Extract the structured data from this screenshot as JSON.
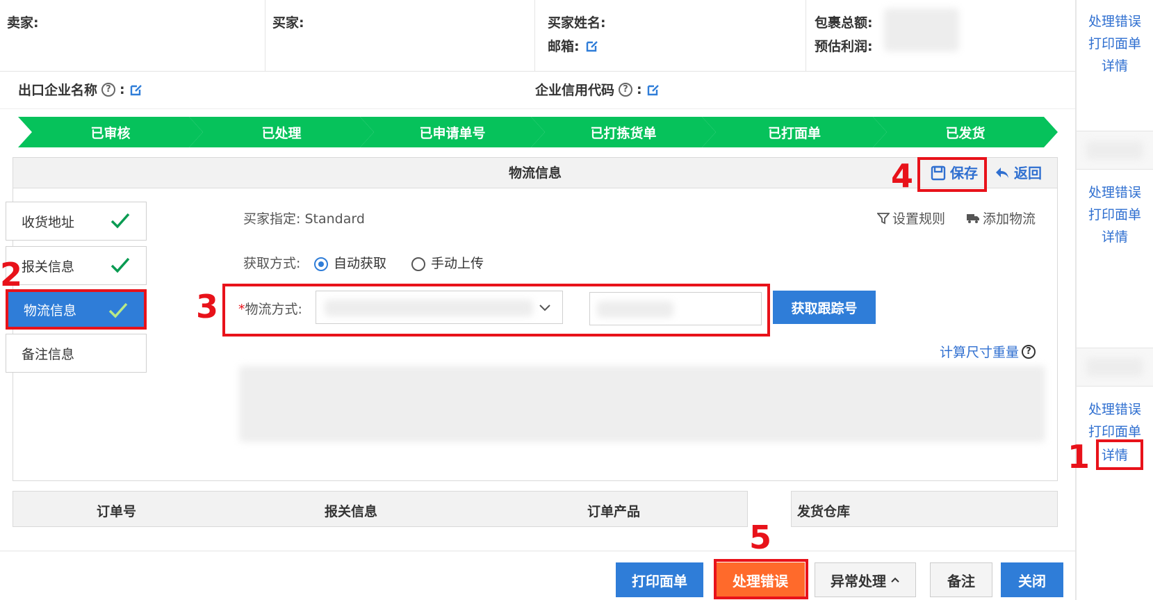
{
  "header": {
    "seller_label": "卖家:",
    "buyer_label": "买家:",
    "buyer_name_label": "买家姓名:",
    "email_label": "邮箱:",
    "package_total_label": "包裹总额:",
    "est_profit_label": "预估利润:"
  },
  "corp": {
    "export_company_label": "出口企业名称",
    "credit_code_label": "企业信用代码",
    "colon": ":"
  },
  "steps": [
    "已审核",
    "已处理",
    "已申请单号",
    "已打拣货单",
    "已打面单",
    "已发货"
  ],
  "panel": {
    "title": "物流信息",
    "save_label": "保存",
    "back_label": "返回"
  },
  "side_tabs": [
    {
      "label": "收货地址"
    },
    {
      "label": "报关信息"
    },
    {
      "label": "物流信息"
    },
    {
      "label": "备注信息"
    }
  ],
  "logistics": {
    "buyer_specified_label": "买家指定:",
    "buyer_specified_value": "Standard",
    "set_rules_label": "设置规则",
    "add_logistics_label": "添加物流",
    "acquire_method_label": "获取方式:",
    "auto_label": "自动获取",
    "manual_label": "手动上传",
    "method_label": "物流方式:",
    "required_mark": "*",
    "get_tracking_label": "获取跟踪号",
    "calc_label": "计算尺寸重量"
  },
  "table_headers": [
    "订单号",
    "报关信息",
    "订单产品",
    "发货仓库"
  ],
  "footer": {
    "print_label": "打印面单",
    "error_label": "处理错误",
    "exception_label": "异常处理",
    "note_label": "备注",
    "close_label": "关闭"
  },
  "right_col": {
    "groups": [
      {
        "error": "处理错误",
        "print": "打印面单",
        "detail": "详情"
      },
      {
        "error": "处理错误",
        "print": "打印面单",
        "detail": "详情"
      },
      {
        "error": "处理错误",
        "print": "打印面单",
        "detail": "详情"
      }
    ]
  },
  "annotations": [
    "1",
    "2",
    "3",
    "4",
    "5"
  ],
  "colors": {
    "step_green": "#06c25b",
    "primary_blue": "#2f7dd8",
    "link_blue": "#2f6fd0",
    "highlight_red": "#e8121a",
    "error_orange": "#ff6a2b"
  }
}
